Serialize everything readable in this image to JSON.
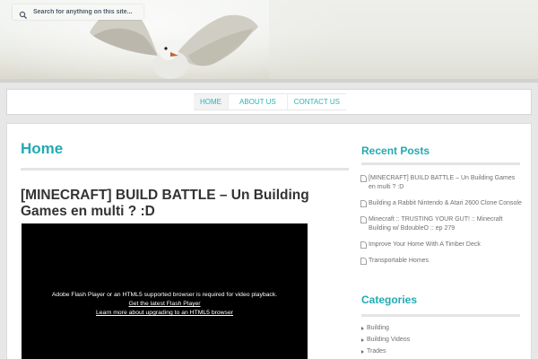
{
  "search": {
    "placeholder": "Search for anything on this site..."
  },
  "nav": {
    "items": [
      {
        "label": "HOME"
      },
      {
        "label": "ABOUT US"
      },
      {
        "label": "CONTACT US"
      }
    ]
  },
  "page": {
    "title": "Home"
  },
  "post": {
    "title": "[MINECRAFT] BUILD BATTLE – Un Building Games en multi ? :D"
  },
  "player": {
    "message": "Adobe Flash Player or an HTML5 supported browser is required for video playback.",
    "link1": "Get the latest Flash Player",
    "link2": "Learn more about upgrading to an HTML5 browser"
  },
  "sidebar": {
    "recent_heading": "Recent Posts",
    "recent_posts": [
      {
        "label": "[MINECRAFT] BUILD BATTLE – Un Building Games en multi ? :D"
      },
      {
        "label": "Building a Rabbit Nintendo & Atari 2600 Clone Console"
      },
      {
        "label": "Minecraft :: TRUSTING YOUR GUT! :: Minecraft Building w/ BdoubleO :: ep 279"
      },
      {
        "label": "Improve Your Home With A Timber Deck"
      },
      {
        "label": "Transportable Homes"
      }
    ],
    "categories_heading": "Categories",
    "categories": [
      {
        "label": "Building"
      },
      {
        "label": "Building Videos"
      },
      {
        "label": "Trades"
      }
    ]
  },
  "colors": {
    "accent": "#22aab3",
    "nav_link": "#2ab4b4",
    "text": "#333333",
    "muted": "#6f6f6f"
  }
}
